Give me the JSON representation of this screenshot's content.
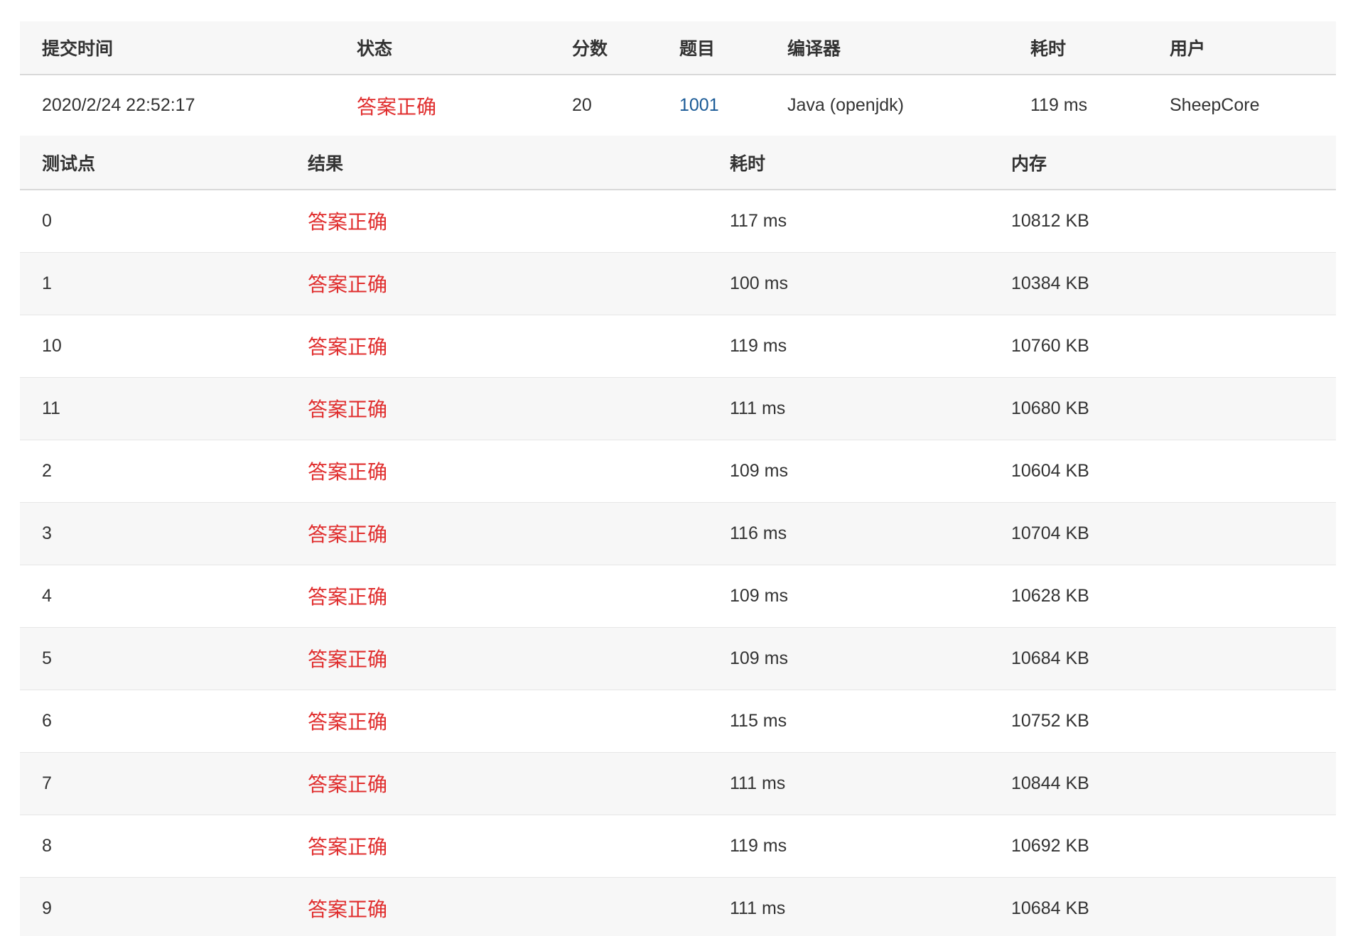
{
  "colors": {
    "accepted": "#e02d2d",
    "link": "#1a5a96",
    "header_bg": "#f7f7f7",
    "stripe_bg": "#f7f7f7"
  },
  "summary": {
    "headers": [
      "提交时间",
      "状态",
      "分数",
      "题目",
      "编译器",
      "耗时",
      "用户"
    ],
    "row": {
      "submit_time": "2020/2/24 22:52:17",
      "status": "答案正确",
      "score": "20",
      "problem": "1001",
      "compiler": "Java (openjdk)",
      "time": "119 ms",
      "user": "SheepCore"
    }
  },
  "cases": {
    "headers": [
      "测试点",
      "结果",
      "耗时",
      "内存"
    ],
    "rows": [
      {
        "id": "0",
        "result": "答案正确",
        "time": "117 ms",
        "memory": "10812 KB"
      },
      {
        "id": "1",
        "result": "答案正确",
        "time": "100 ms",
        "memory": "10384 KB"
      },
      {
        "id": "10",
        "result": "答案正确",
        "time": "119 ms",
        "memory": "10760 KB"
      },
      {
        "id": "11",
        "result": "答案正确",
        "time": "111 ms",
        "memory": "10680 KB"
      },
      {
        "id": "2",
        "result": "答案正确",
        "time": "109 ms",
        "memory": "10604 KB"
      },
      {
        "id": "3",
        "result": "答案正确",
        "time": "116 ms",
        "memory": "10704 KB"
      },
      {
        "id": "4",
        "result": "答案正确",
        "time": "109 ms",
        "memory": "10628 KB"
      },
      {
        "id": "5",
        "result": "答案正确",
        "time": "109 ms",
        "memory": "10684 KB"
      },
      {
        "id": "6",
        "result": "答案正确",
        "time": "115 ms",
        "memory": "10752 KB"
      },
      {
        "id": "7",
        "result": "答案正确",
        "time": "111 ms",
        "memory": "10844 KB"
      },
      {
        "id": "8",
        "result": "答案正确",
        "time": "119 ms",
        "memory": "10692 KB"
      },
      {
        "id": "9",
        "result": "答案正确",
        "time": "111 ms",
        "memory": "10684 KB"
      }
    ]
  }
}
